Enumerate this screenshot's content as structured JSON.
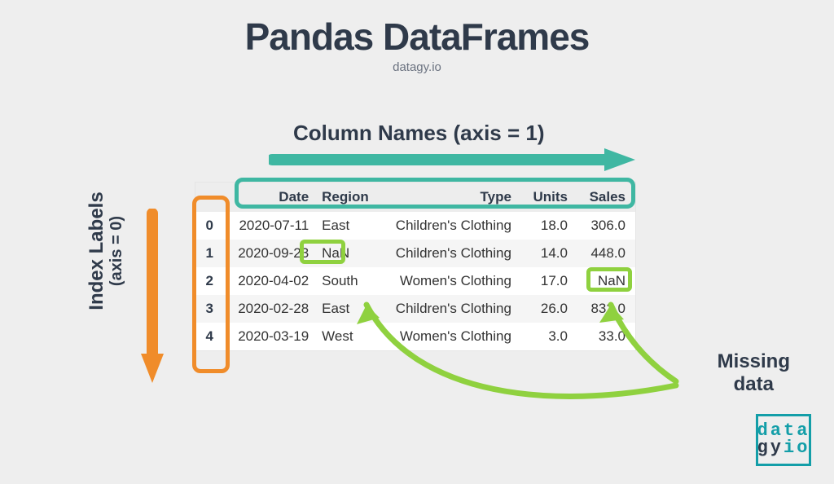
{
  "title": "Pandas DataFrames",
  "subtitle": "datagy.io",
  "annotations": {
    "columns_label": "Column Names (axis = 1)",
    "index_label": "Index Labels",
    "index_sublabel": "(axis = 0)",
    "missing_label": "Missing\ndata"
  },
  "columns": [
    "Date",
    "Region",
    "Type",
    "Units",
    "Sales"
  ],
  "index": [
    0,
    1,
    2,
    3,
    4
  ],
  "rows": [
    {
      "Date": "2020-07-11",
      "Region": "East",
      "Type": "Children's Clothing",
      "Units": "18.0",
      "Sales": "306.0"
    },
    {
      "Date": "2020-09-23",
      "Region": "NaN",
      "Type": "Children's Clothing",
      "Units": "14.0",
      "Sales": "448.0"
    },
    {
      "Date": "2020-04-02",
      "Region": "South",
      "Type": "Women's Clothing",
      "Units": "17.0",
      "Sales": "NaN"
    },
    {
      "Date": "2020-02-28",
      "Region": "East",
      "Type": "Children's Clothing",
      "Units": "26.0",
      "Sales": "832.0"
    },
    {
      "Date": "2020-03-19",
      "Region": "West",
      "Type": "Women's Clothing",
      "Units": "3.0",
      "Sales": "33.0"
    }
  ],
  "colors": {
    "teal": "#3fb7a2",
    "orange": "#f08c2a",
    "lime": "#8fd13f",
    "brand": "#139ea8",
    "dark": "#2f3a4a"
  },
  "logo": {
    "line1": "data",
    "line2a": "gy",
    "line2b": "io"
  }
}
